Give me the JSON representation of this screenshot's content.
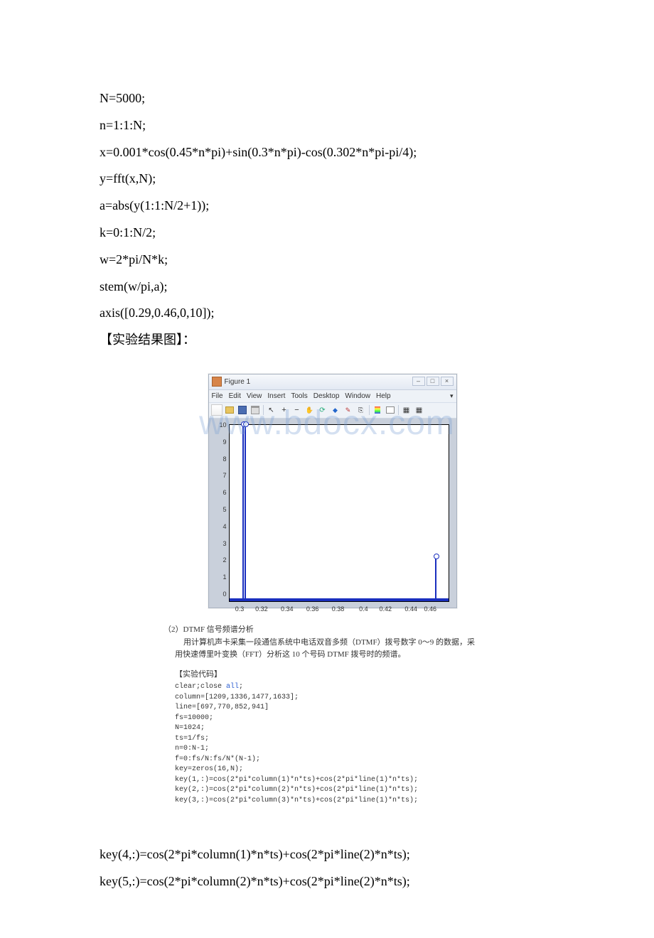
{
  "watermark": "www.bdocx.com",
  "code_lines_top": [
    "N=5000;",
    "n=1:1:N;",
    "x=0.001*cos(0.45*n*pi)+sin(0.3*n*pi)-cos(0.302*n*pi-pi/4);",
    "y=fft(x,N);",
    "a=abs(y(1:1:N/2+1));",
    "k=0:1:N/2;",
    "w=2*pi/N*k;",
    "stem(w/pi,a);",
    "axis([0.29,0.46,0,10]);"
  ],
  "result_label": "【实验结果图】：",
  "figure_window": {
    "title": "Figure 1",
    "menus": [
      "File",
      "Edit",
      "View",
      "Insert",
      "Tools",
      "Desktop",
      "Window",
      "Help"
    ],
    "win_ctrl": [
      "–",
      "□",
      "×"
    ]
  },
  "chart_data": {
    "type": "bar",
    "xlabel": "",
    "ylabel": "",
    "xlim": [
      0.29,
      0.46
    ],
    "ylim": [
      0,
      10
    ],
    "xticks": [
      "0.3",
      "0.32",
      "0.34",
      "0.36",
      "0.38",
      "0.4",
      "0.42",
      "0.44",
      "0.46"
    ],
    "yticks": [
      "10",
      "9",
      "8",
      "7",
      "6",
      "5",
      "4",
      "3",
      "2",
      "1",
      "0"
    ],
    "stems": [
      {
        "x": 0.3,
        "y": 10.0
      },
      {
        "x": 0.302,
        "y": 10.0
      },
      {
        "x": 0.45,
        "y": 2.5
      }
    ]
  },
  "section2": {
    "heading": "（2）DTMF 信号频谱分析",
    "body1": "用计算机声卡采集一段通信系统中电话双音多频（DTMF）拨号数字 0～9 的数据，采",
    "body2": "用快速傅里叶变换（FFT）分析这 10 个号码 DTMF 拨号时的频谱。",
    "sub_heading": "【实验代码】",
    "mono": [
      {
        "t": "clear;",
        "kw": false
      },
      {
        "t": "close ",
        "kw": false
      },
      {
        "t": "all",
        "kw": true
      },
      {
        "t": ";",
        "kw": false,
        "br": true
      },
      {
        "t": "column=[1209,1336,1477,1633];",
        "kw": false,
        "br": true
      },
      {
        "t": "line=[697,770,852,941]",
        "kw": false,
        "br": true
      },
      {
        "t": "fs=10000;",
        "kw": false,
        "br": true
      },
      {
        "t": "N=1024;",
        "kw": false,
        "br": true
      },
      {
        "t": "ts=1/fs;",
        "kw": false,
        "br": true
      },
      {
        "t": "n=0:N-1;",
        "kw": false,
        "br": true
      },
      {
        "t": "f=0:fs/N:fs/N*(N-1);",
        "kw": false,
        "br": true
      },
      {
        "t": "",
        "kw": false,
        "br": true
      },
      {
        "t": "key=zeros(16,N);",
        "kw": false,
        "br": true
      },
      {
        "t": "key(1,:)=cos(2*pi*column(1)*n*ts)+cos(2*pi*line(1)*n*ts);",
        "kw": false,
        "br": true
      },
      {
        "t": "key(2,:)=cos(2*pi*column(2)*n*ts)+cos(2*pi*line(1)*n*ts);",
        "kw": false,
        "br": true
      },
      {
        "t": "key(3,:)=cos(2*pi*column(3)*n*ts)+cos(2*pi*line(1)*n*ts);",
        "kw": false,
        "br": true
      }
    ]
  },
  "code_lines_bottom": [
    "key(4,:)=cos(2*pi*column(1)*n*ts)+cos(2*pi*line(2)*n*ts);",
    "key(5,:)=cos(2*pi*column(2)*n*ts)+cos(2*pi*line(2)*n*ts);"
  ]
}
